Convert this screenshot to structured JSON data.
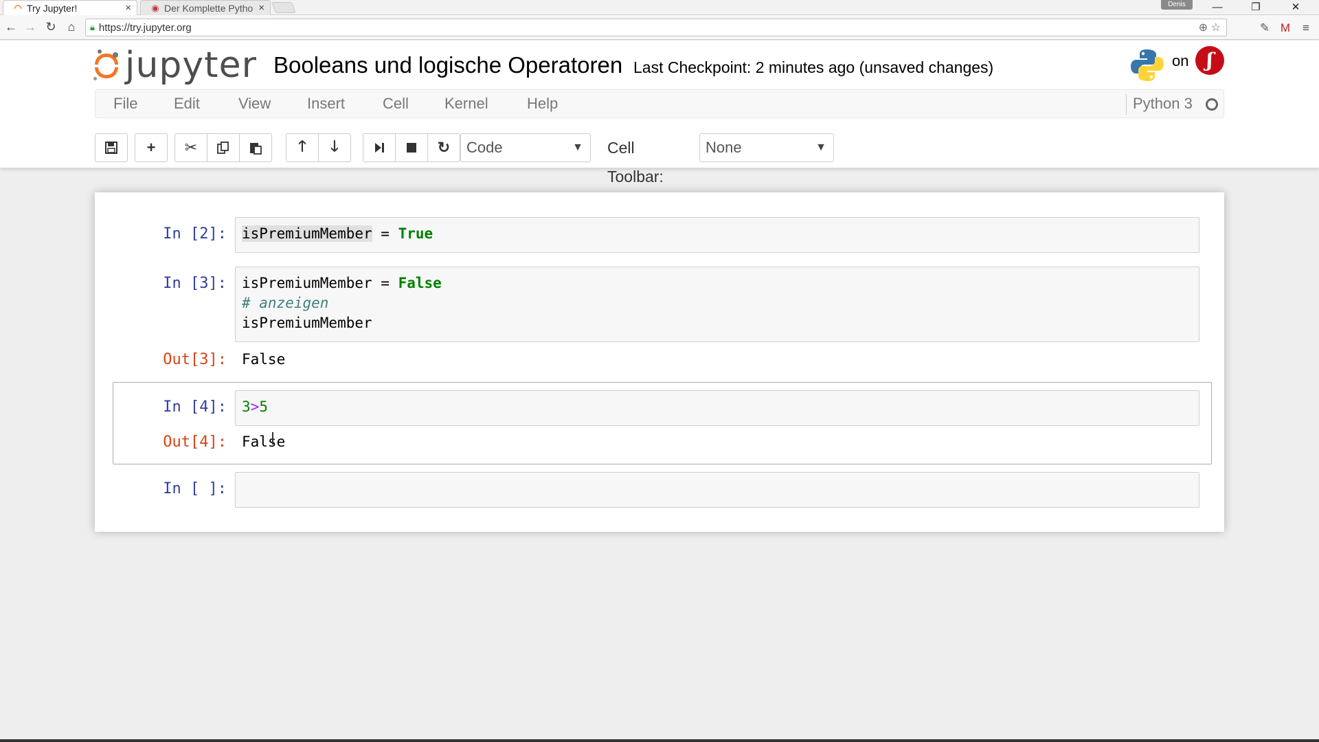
{
  "browser": {
    "tabs": [
      {
        "title": "Try Jupyter!",
        "active": true
      },
      {
        "title": "Der Komplette Pytho",
        "active": false
      }
    ],
    "profile": "Denis",
    "url": "https://try.jupyter.org",
    "window_controls": {
      "minimize": "—",
      "restore": "❐",
      "close": "✕"
    }
  },
  "header": {
    "logo_text": "jupyter",
    "notebook_title": "Booleans und logische Operatoren",
    "checkpoint": "Last Checkpoint: 2 minutes ago (unsaved changes)",
    "on_text": "on"
  },
  "menu": {
    "items": [
      "File",
      "Edit",
      "View",
      "Insert",
      "Cell",
      "Kernel",
      "Help"
    ],
    "kernel_name": "Python 3"
  },
  "toolbar": {
    "cell_type": "Code",
    "cell_toolbar_label": "Cell Toolbar:",
    "cell_toolbar_value": "None"
  },
  "cells": [
    {
      "prompt": "In [2]:",
      "code_var": "isPremiumMember",
      "code_op": " = ",
      "code_kw": "True"
    },
    {
      "prompt": "In [3]:",
      "line1_var": "isPremiumMember = ",
      "line1_kw": "False",
      "line2_comment": "# anzeigen",
      "line3": "isPremiumMember",
      "out_prompt": "Out[3]:",
      "output": "False"
    },
    {
      "prompt": "In [4]:",
      "num_a": "3",
      "op": ">",
      "num_b": "5",
      "out_prompt": "Out[4]:",
      "output": "False"
    },
    {
      "prompt": "In [ ]:"
    }
  ],
  "colors": {
    "jupyter_orange": "#f37626",
    "prompt_in": "#303f9f",
    "prompt_out": "#d84315",
    "keyword_green": "#008000"
  }
}
